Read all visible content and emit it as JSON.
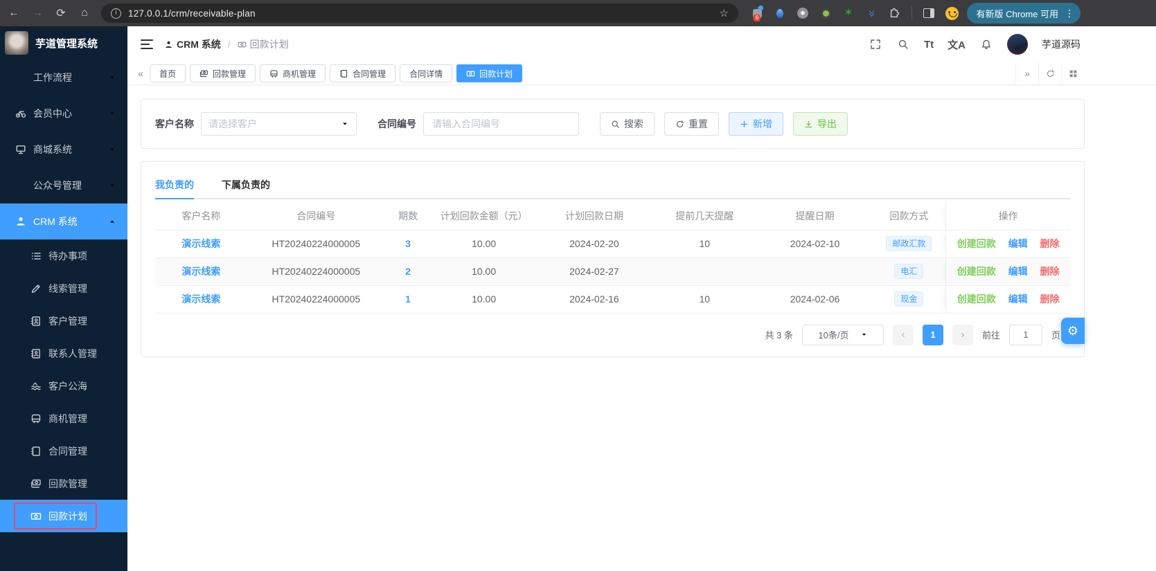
{
  "browser": {
    "url": "127.0.0.1/crm/receivable-plan",
    "extension_badge": "6",
    "update_label": "有新版 Chrome 可用"
  },
  "sidebar": {
    "app_title": "芋道管理系统",
    "items": [
      {
        "label": "工作流程"
      },
      {
        "label": "会员中心"
      },
      {
        "label": "商城系统"
      },
      {
        "label": "公众号管理"
      },
      {
        "label": "CRM 系统"
      },
      {
        "label": "待办事项"
      },
      {
        "label": "线索管理"
      },
      {
        "label": "客户管理"
      },
      {
        "label": "联系人管理"
      },
      {
        "label": "客户公海"
      },
      {
        "label": "商机管理"
      },
      {
        "label": "合同管理"
      },
      {
        "label": "回款管理"
      },
      {
        "label": "回款计划"
      }
    ]
  },
  "navbar": {
    "breadcrumb_parent": "CRM 系统",
    "breadcrumb_sep": "/",
    "breadcrumb_current": "回款计划",
    "font_size_label": "Tt",
    "lang_label": "文A",
    "username": "芋道源码"
  },
  "tabsbar": {
    "tabs": [
      {
        "label": "首页"
      },
      {
        "label": "回款管理"
      },
      {
        "label": "商机管理"
      },
      {
        "label": "合同管理"
      },
      {
        "label": "合同详情"
      },
      {
        "label": "回款计划"
      }
    ]
  },
  "filter": {
    "customer_label": "客户名称",
    "customer_placeholder": "请选择客户",
    "contract_label": "合同编号",
    "contract_placeholder": "请输入合同编号",
    "search_label": "搜索",
    "reset_label": "重置",
    "add_label": "新增",
    "export_label": "导出"
  },
  "panel": {
    "tab_mine": "我负责的",
    "tab_subordinate": "下属负责的",
    "columns": [
      "客户名称",
      "合同编号",
      "期数",
      "计划回款金额（元）",
      "计划回款日期",
      "提前几天提醒",
      "提醒日期",
      "回款方式",
      "操作"
    ],
    "rows": [
      {
        "customer": "演示线索",
        "contract": "HT20240224000005",
        "period": "3",
        "amount": "10.00",
        "plan_date": "2024-02-20",
        "remind_days": "10",
        "remind_date": "2024-02-10",
        "method": "邮政汇款"
      },
      {
        "customer": "演示线索",
        "contract": "HT20240224000005",
        "period": "2",
        "amount": "10.00",
        "plan_date": "2024-02-27",
        "remind_days": "",
        "remind_date": "",
        "method": "电汇"
      },
      {
        "customer": "演示线索",
        "contract": "HT20240224000005",
        "period": "1",
        "amount": "10.00",
        "plan_date": "2024-02-16",
        "remind_days": "10",
        "remind_date": "2024-02-06",
        "method": "现金"
      }
    ],
    "actions": {
      "create": "创建回款",
      "edit": "编辑",
      "delete": "删除"
    },
    "pagination": {
      "total": "共 3 条",
      "page_size": "10条/页",
      "current_page": "1",
      "goto_label": "前往",
      "goto_value": "1",
      "page_unit": "页"
    }
  },
  "colors": {
    "primary": "#409eff",
    "success": "#67c23a",
    "danger": "#f56c6c",
    "highlight_box": "#f0436e"
  }
}
